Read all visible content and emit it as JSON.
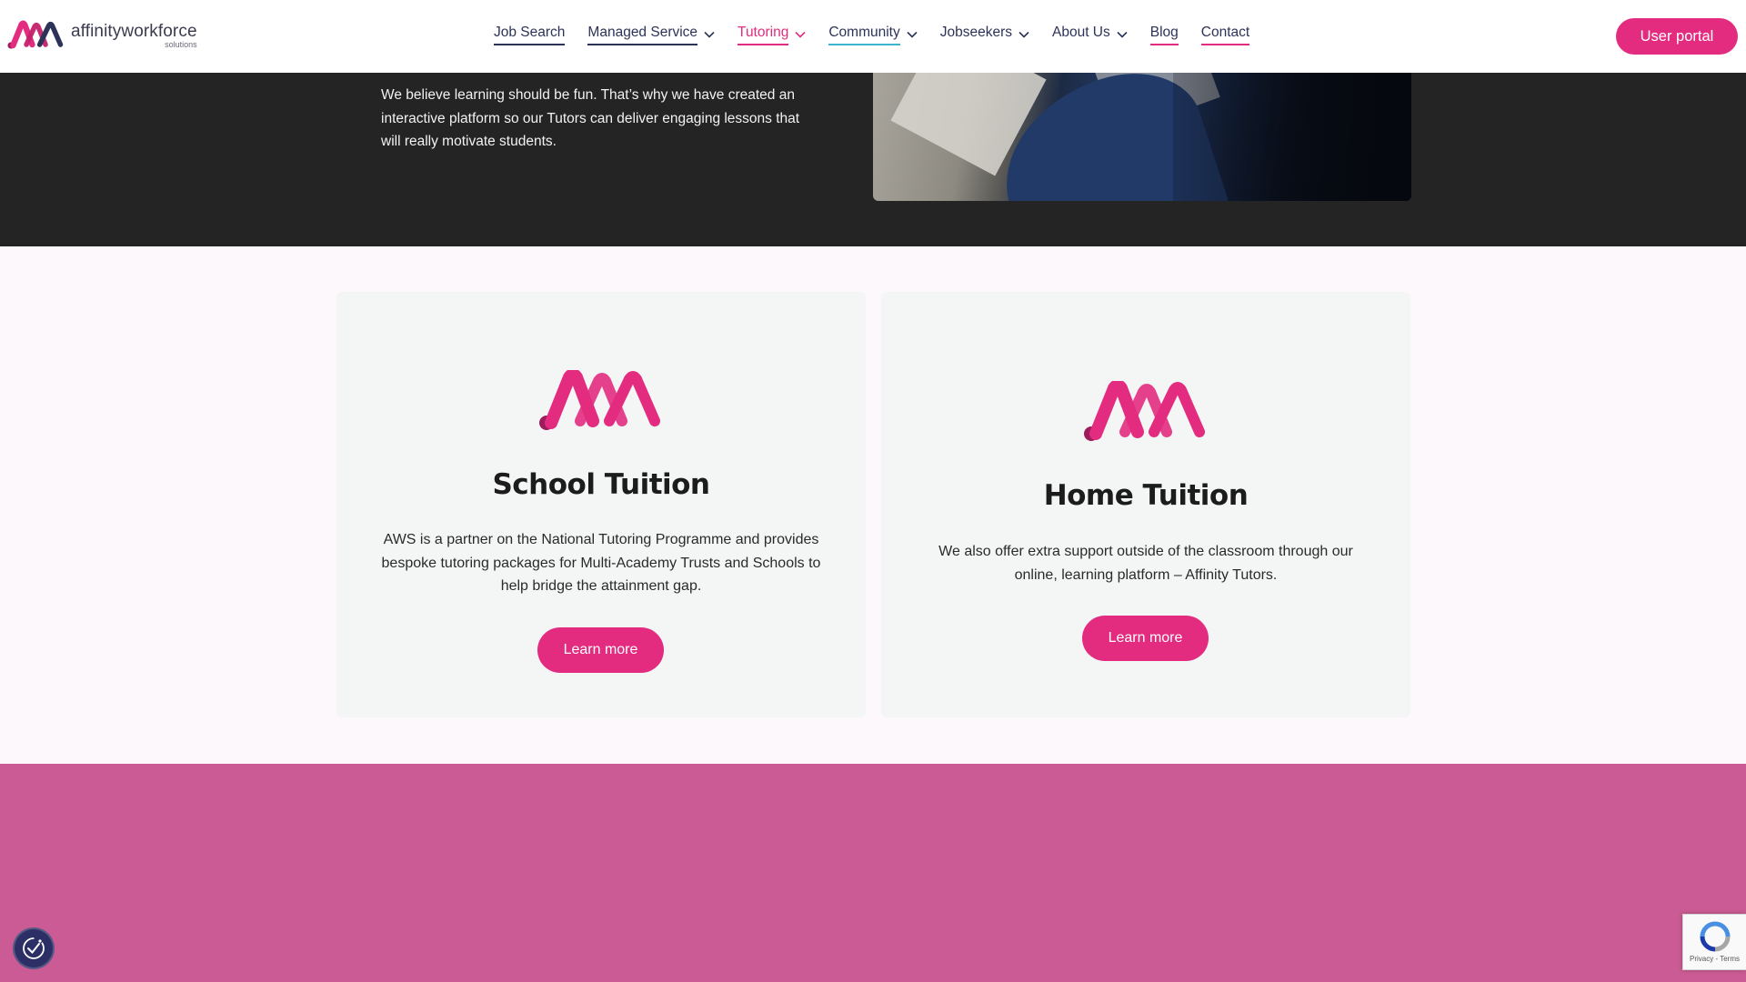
{
  "brand": {
    "name": "affinityworkforce",
    "sub": "solutions",
    "pink": "#e32c7f",
    "navy": "#2d3358"
  },
  "nav": {
    "items": [
      {
        "label": "Job Search",
        "has_dropdown": false,
        "underline": "navy"
      },
      {
        "label": "Managed Service",
        "has_dropdown": true,
        "underline": "navy"
      },
      {
        "label": "Tutoring",
        "has_dropdown": true,
        "underline": "pink",
        "active": true
      },
      {
        "label": "Community",
        "has_dropdown": true,
        "underline": "teal"
      },
      {
        "label": "Jobseekers",
        "has_dropdown": true,
        "underline": "none"
      },
      {
        "label": "About Us",
        "has_dropdown": true,
        "underline": "none"
      },
      {
        "label": "Blog",
        "has_dropdown": false,
        "underline": "pink"
      },
      {
        "label": "Contact",
        "has_dropdown": false,
        "underline": "pink"
      }
    ],
    "portal_label": "User portal"
  },
  "hero": {
    "text": "We believe learning should be fun. That’s why we have created an interactive platform so our Tutors can deliver engaging lessons that will really motivate students."
  },
  "cards": [
    {
      "title": "School Tuition",
      "text": "AWS is a partner on the National Tutoring Programme and provides bespoke tutoring packages for Multi-Academy Trusts and Schools to help bridge the attainment gap.",
      "button": "Learn more"
    },
    {
      "title": "Home Tuition",
      "text": "We also offer extra support outside of the classroom through our online, learning platform – Affinity Tutors.",
      "button": "Learn more"
    }
  ],
  "recaptcha": {
    "terms": "Privacy - Terms"
  },
  "icons": {
    "accessibility": "accessibility-icon",
    "recaptcha": "recaptcha-icon",
    "chevron": "chevron-down-icon"
  }
}
